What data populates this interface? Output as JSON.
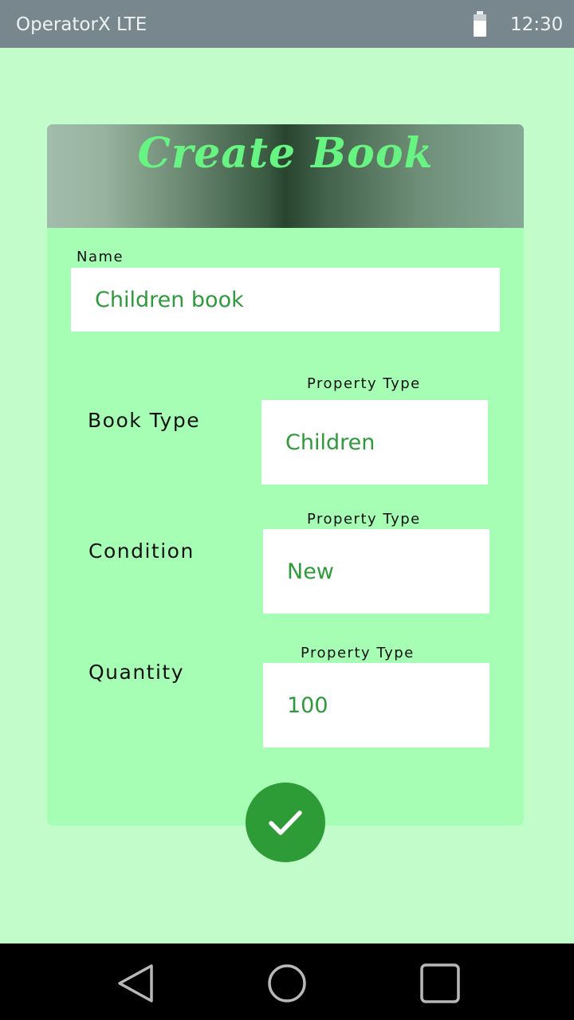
{
  "status_bar": {
    "carrier": "OperatorX LTE",
    "time": "12:30",
    "battery_icon": "battery-icon"
  },
  "form": {
    "title": "Create Book",
    "name": {
      "label": "Name",
      "value": "Children book"
    },
    "book_type": {
      "label": "Book Type",
      "caption": "Property Type",
      "value": "Children"
    },
    "condition": {
      "label": "Condition",
      "caption": "Property Type",
      "value": "New"
    },
    "quantity": {
      "label": "Quantity",
      "caption": "Property Type",
      "value": "100"
    },
    "submit_icon": "checkmark-icon"
  },
  "nav_bar": {
    "back_icon": "back-triangle-icon",
    "home_icon": "home-circle-icon",
    "recents_icon": "recents-square-icon"
  },
  "colors": {
    "background": "#c2fcca",
    "card": "#a5feb3",
    "title": "#68f482",
    "value_text": "#2e9a3b",
    "fab": "#2e9c36",
    "status_bar": "#78878e"
  }
}
